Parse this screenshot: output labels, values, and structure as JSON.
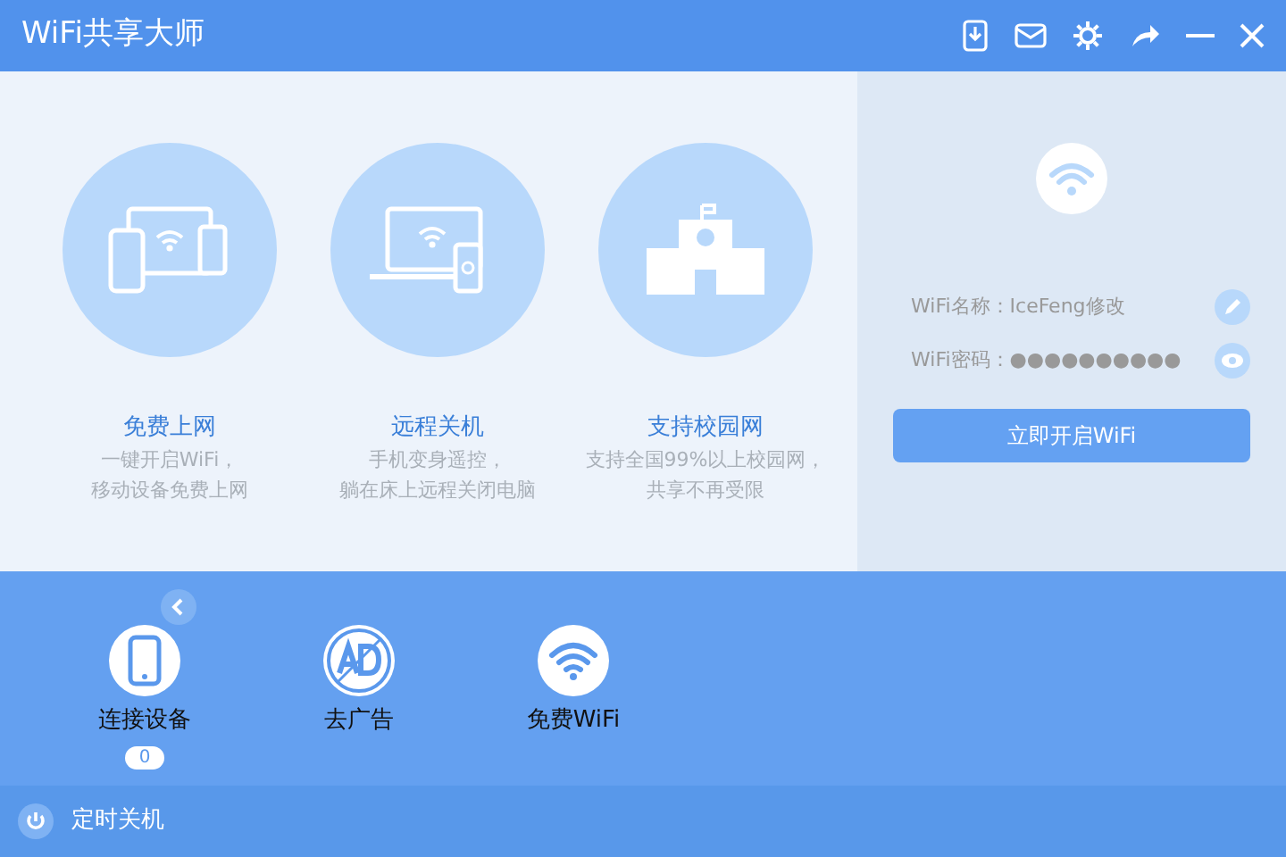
{
  "window": {
    "title": "WiFi共享大师"
  },
  "features": [
    {
      "kind": "devices",
      "title": "免费上网",
      "lines": [
        "一键开启WiFi，",
        "移动设备免费上网"
      ]
    },
    {
      "kind": "laptop",
      "title": "远程关机",
      "lines": [
        "手机变身遥控，",
        "躺在床上远程关闭电脑"
      ]
    },
    {
      "kind": "school",
      "title": "支持校园网",
      "lines": [
        "支持全国99%以上校园网，",
        "共享不再受限"
      ]
    }
  ],
  "wifi_panel": {
    "name_label": "WiFi名称：IceFeng修改",
    "password_label": "WiFi密码：●●●●●●●●●●",
    "start_button": "立即开启WiFi"
  },
  "tools": [
    {
      "kind": "phone",
      "label": "连接设备",
      "count": "0"
    },
    {
      "kind": "ad",
      "label": "去广告"
    },
    {
      "kind": "wifi",
      "label": "免费WiFi"
    }
  ],
  "footer": {
    "label": "定时关机"
  }
}
